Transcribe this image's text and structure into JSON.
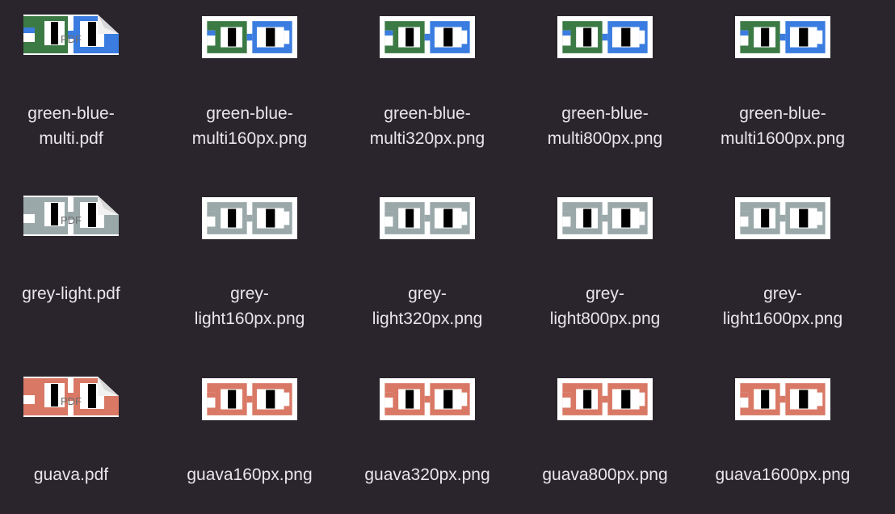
{
  "window": {
    "view": "icon-grid"
  },
  "colors": {
    "background": "#2a252c",
    "label_text": "#e8e6ea",
    "green": "#3c7a45",
    "blue": "#3a7ce0",
    "grey": "#9aa8a9",
    "guava": "#d87865"
  },
  "pdf_badge": "PDF",
  "rows": [
    {
      "palette": "green-blue",
      "files": [
        {
          "name": "green-blue-\nmulti.pdf",
          "kind": "pdf"
        },
        {
          "name": "green-blue-\nmulti160px.png",
          "kind": "png"
        },
        {
          "name": "green-blue-\nmulti320px.png",
          "kind": "png"
        },
        {
          "name": "green-blue-\nmulti800px.png",
          "kind": "png"
        },
        {
          "name": "green-blue-\nmulti1600px.png",
          "kind": "png"
        }
      ]
    },
    {
      "palette": "grey",
      "files": [
        {
          "name": "grey-light.pdf",
          "kind": "pdf"
        },
        {
          "name": "grey-\nlight160px.png",
          "kind": "png"
        },
        {
          "name": "grey-\nlight320px.png",
          "kind": "png"
        },
        {
          "name": "grey-\nlight800px.png",
          "kind": "png"
        },
        {
          "name": "grey-\nlight1600px.png",
          "kind": "png"
        }
      ]
    },
    {
      "palette": "guava",
      "files": [
        {
          "name": "guava.pdf",
          "kind": "pdf"
        },
        {
          "name": "guava160px.png",
          "kind": "png"
        },
        {
          "name": "guava320px.png",
          "kind": "png"
        },
        {
          "name": "guava800px.png",
          "kind": "png"
        },
        {
          "name": "guava1600px.png",
          "kind": "png"
        }
      ]
    }
  ]
}
